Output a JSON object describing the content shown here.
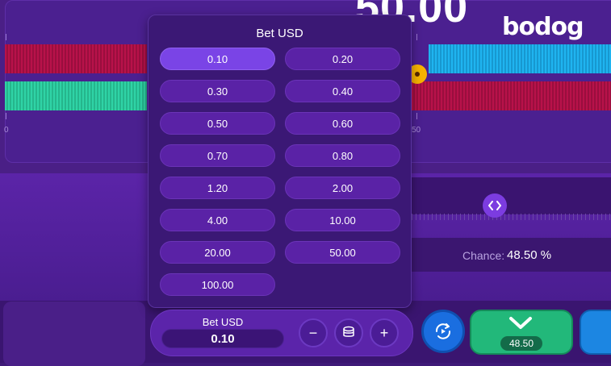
{
  "game": {
    "big_number": "50.00",
    "brand": "bodog"
  },
  "axis": {
    "left_label": "0",
    "mid_label": "50"
  },
  "chance": {
    "label": "Chance:",
    "value": "48.50 %"
  },
  "bet_panel": {
    "title": "Bet USD",
    "options": [
      "0.10",
      "0.20",
      "0.30",
      "0.40",
      "0.50",
      "0.60",
      "0.70",
      "0.80",
      "1.20",
      "2.00",
      "4.00",
      "10.00",
      "20.00",
      "50.00",
      "100.00"
    ],
    "selected": "0.10"
  },
  "bet_control": {
    "title": "Bet USD",
    "value": "0.10",
    "minus_label": "−",
    "plus_label": "+"
  },
  "actions": {
    "roll_under_value": "48.50"
  },
  "colors": {
    "accent": "#7a44e6",
    "green": "#22b87a",
    "blue": "#1a6ee0",
    "red_bar": "#b8124a",
    "teal_bar": "#2fd3a6",
    "cyan_bar": "#1fb4f0",
    "marker": "#f5b300"
  }
}
